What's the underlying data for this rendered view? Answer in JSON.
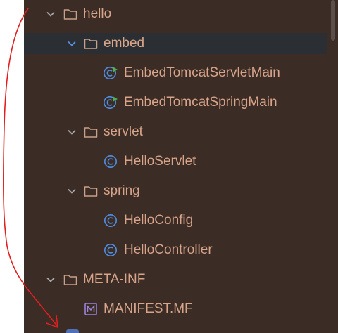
{
  "tree": {
    "items": [
      {
        "label": "hello",
        "type": "folder",
        "expanded": true
      },
      {
        "label": "embed",
        "type": "folder",
        "expanded": true,
        "selected": true
      },
      {
        "label": "EmbedTomcatServletMain",
        "type": "runnable-class"
      },
      {
        "label": "EmbedTomcatSpringMain",
        "type": "runnable-class"
      },
      {
        "label": "servlet",
        "type": "folder",
        "expanded": true
      },
      {
        "label": "HelloServlet",
        "type": "class"
      },
      {
        "label": "spring",
        "type": "folder",
        "expanded": true
      },
      {
        "label": "HelloConfig",
        "type": "class"
      },
      {
        "label": "HelloController",
        "type": "class"
      },
      {
        "label": "META-INF",
        "type": "folder",
        "expanded": true
      },
      {
        "label": "MANIFEST.MF",
        "type": "manifest-file"
      }
    ]
  },
  "colors": {
    "panel_background": "#3b2c25",
    "selected_row": "#2b2e33",
    "label_text": "#d8a48a",
    "folder_icon": "#c9a08a",
    "chevron": "#a8a8a8",
    "chevron_selected": "#5a8ee0",
    "class_icon": "#4f8fe6",
    "run_badge": "#4caf50",
    "manifest_icon": "#9c82d8",
    "annotation_stroke": "#e02020"
  }
}
